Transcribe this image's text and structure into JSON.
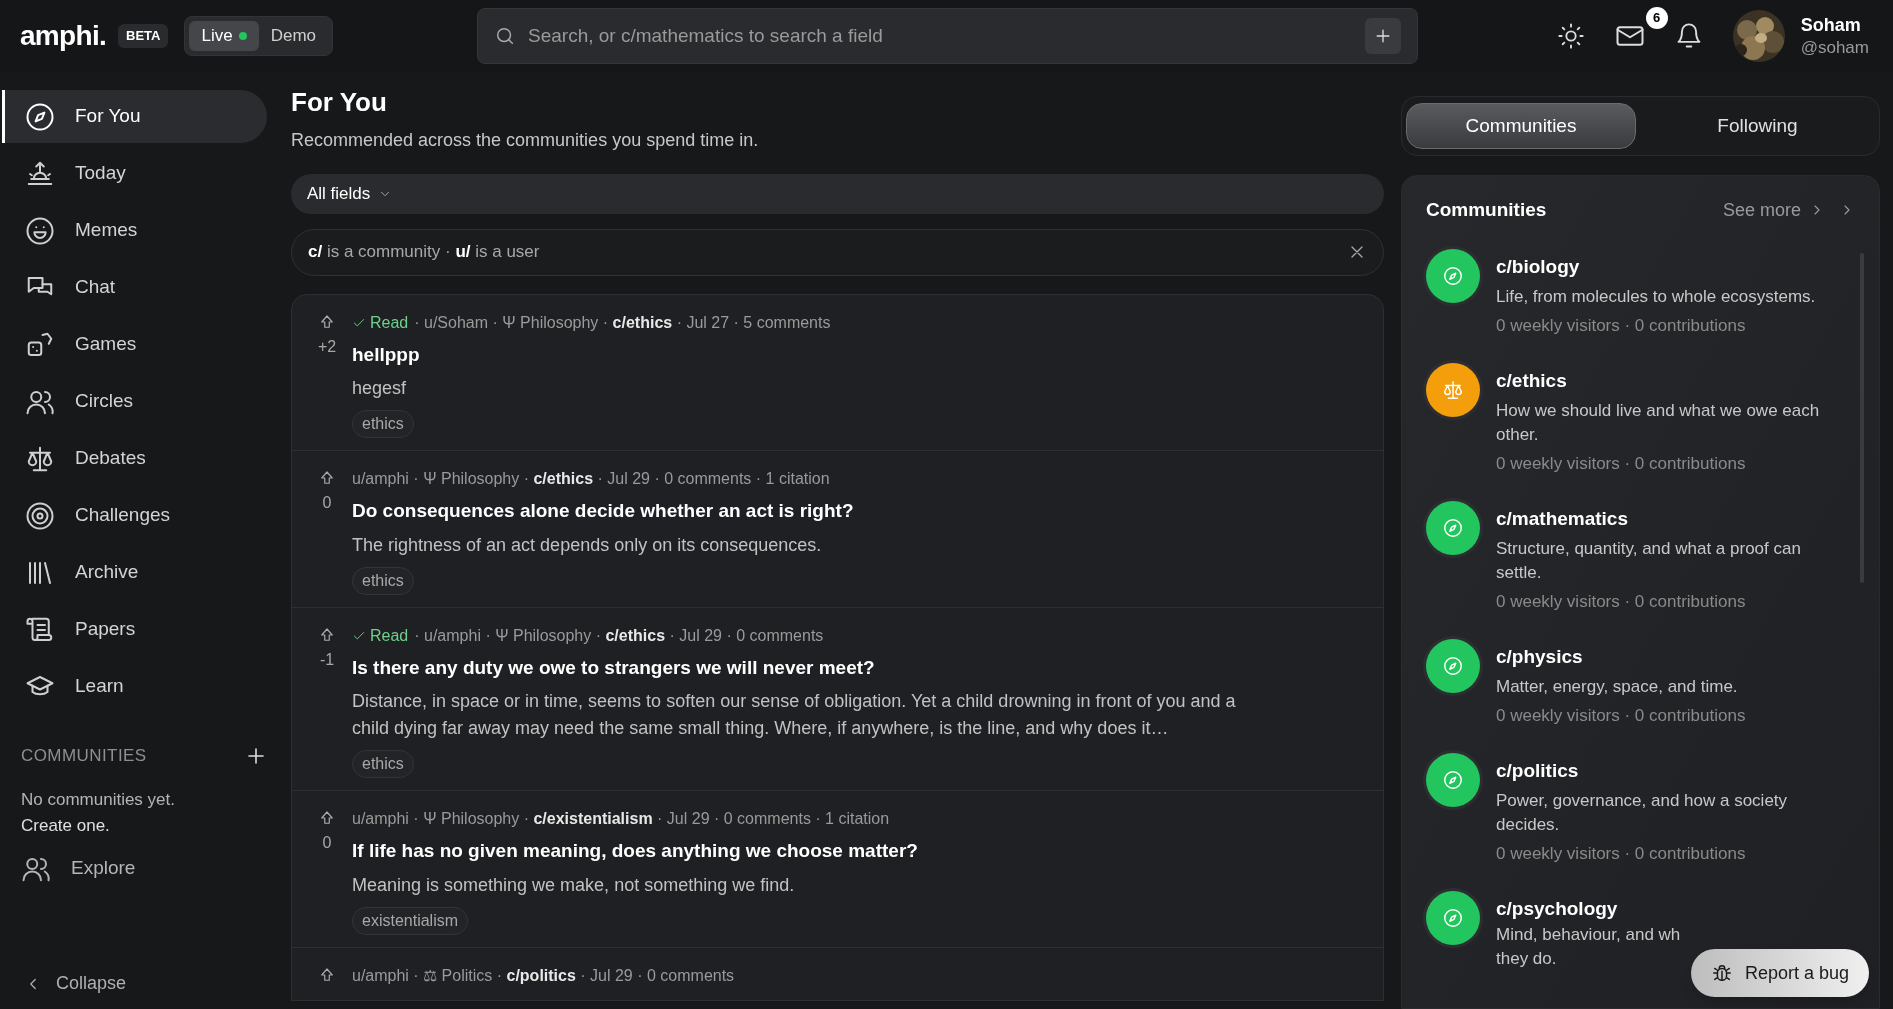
{
  "header": {
    "logo": "amphi.",
    "beta": "BETA",
    "modes": [
      {
        "label": "Live",
        "selected": true,
        "live_dot": true
      },
      {
        "label": "Demo",
        "selected": false,
        "live_dot": false
      }
    ],
    "search": {
      "placeholder": "Search, or c/mathematics to search a field"
    },
    "mail_count": "6",
    "user": {
      "name": "Soham",
      "handle": "@soham"
    }
  },
  "sidebar": {
    "items": [
      {
        "label": "For You",
        "kind": "compass",
        "selected": true
      },
      {
        "label": "Today",
        "kind": "sunrise",
        "selected": false
      },
      {
        "label": "Memes",
        "kind": "smile",
        "selected": false
      },
      {
        "label": "Chat",
        "kind": "chat",
        "selected": false
      },
      {
        "label": "Games",
        "kind": "dice",
        "selected": false
      },
      {
        "label": "Circles",
        "kind": "people",
        "selected": false
      },
      {
        "label": "Debates",
        "kind": "scales",
        "selected": false
      },
      {
        "label": "Challenges",
        "kind": "target",
        "selected": false
      },
      {
        "label": "Archive",
        "kind": "books",
        "selected": false
      },
      {
        "label": "Papers",
        "kind": "scroll",
        "selected": false
      },
      {
        "label": "Learn",
        "kind": "cap",
        "selected": false
      }
    ],
    "communities_heading": "COMMUNITIES",
    "empty_lines": [
      "No communities yet.",
      "Create one."
    ],
    "explore": "Explore",
    "collapse": "Collapse"
  },
  "main": {
    "title": "For You",
    "subtitle": "Recommended across the communities you spend time in.",
    "filter": "All fields",
    "hint": "**c/** is a community · **u/** is a user",
    "posts": [
      {
        "votes": "+2",
        "read": true,
        "read_label": "Read",
        "meta": "· u/Soham · Ψ Philosophy · **c/ethics** · Jul 27 · 5 comments",
        "title": "hellppp",
        "body": "hegesf",
        "tag": "ethics"
      },
      {
        "votes": "0",
        "read": false,
        "meta": "u/amphi · Ψ Philosophy · **c/ethics** · Jul 29 · 0 comments · 1 citation",
        "title": "Do consequences alone decide whether an act is right?",
        "body": "The rightness of an act depends only on its consequences.",
        "tag": "ethics"
      },
      {
        "votes": "-1",
        "read": true,
        "read_label": "Read",
        "meta": "· u/amphi · Ψ Philosophy · **c/ethics** · Jul 29 · 0 comments",
        "title": "Is there any duty we owe to strangers we will never meet?",
        "body": "Distance, in space or in time, seems to soften our sense of obligation. Yet a child drowning in front of you and a child dying far away may need the same small thing. Where, if anywhere, is the line, and why does it…",
        "tag": "ethics"
      },
      {
        "votes": "0",
        "read": false,
        "meta": "u/amphi · Ψ Philosophy · **c/existentialism** · Jul 29 · 0 comments · 1 citation",
        "title": "If life has no given meaning, does anything we choose matter?",
        "body": "Meaning is something we make, not something we find.",
        "tag": "existentialism"
      },
      {
        "read": false,
        "meta": "u/amphi · ⚖ Politics · **c/politics** · Jul 29 · 0 comments"
      }
    ]
  },
  "right": {
    "tabs": [
      {
        "label": "Communities",
        "selected": true
      },
      {
        "label": "Following",
        "selected": false
      }
    ],
    "card_title": "Communities",
    "see_more": "See more",
    "communities": [
      {
        "name": "c/biology",
        "kind": "compass",
        "color": "#22c55e",
        "description": "Life, from molecules to whole ecosystems.",
        "stats": "0 weekly visitors · 0 contributions"
      },
      {
        "name": "c/ethics",
        "kind": "scales",
        "color": "#f59e0b",
        "description": "How we should live and what we owe each other.",
        "stats": "0 weekly visitors · 0 contributions"
      },
      {
        "name": "c/mathematics",
        "kind": "compass",
        "color": "#22c55e",
        "description": "Structure, quantity, and what a proof can settle.",
        "stats": "0 weekly visitors · 0 contributions"
      },
      {
        "name": "c/physics",
        "kind": "compass",
        "color": "#22c55e",
        "description": "Matter, energy, space, and time.",
        "stats": "0 weekly visitors · 0 contributions"
      },
      {
        "name": "c/politics",
        "kind": "compass",
        "color": "#22c55e",
        "description": "Power, governance, and how a society decides.",
        "stats": "0 weekly visitors · 0 contributions"
      },
      {
        "name": "c/psychology",
        "kind": "compass",
        "color": "#22c55e",
        "description_lines": [
          "Mind, behaviour, and wh",
          "they do."
        ]
      }
    ],
    "report_bug": "Report a bug"
  }
}
